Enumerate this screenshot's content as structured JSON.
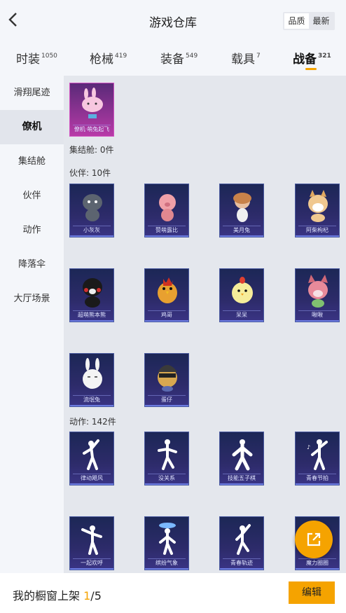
{
  "header": {
    "title": "游戏仓库",
    "sort_options": [
      "品质",
      "最新"
    ]
  },
  "tabs": [
    {
      "label": "时装",
      "count": "1050"
    },
    {
      "label": "枪械",
      "count": "419"
    },
    {
      "label": "装备",
      "count": "549"
    },
    {
      "label": "载具",
      "count": "7"
    },
    {
      "label": "战备",
      "count": "321"
    }
  ],
  "sidebar": [
    "滑翔尾迹",
    "僚机",
    "集结舱",
    "伙伴",
    "动作",
    "降落伞",
    "大厅场景"
  ],
  "sections": {
    "wingman_item": "僚机·萌兔起飞",
    "assembly_label": "集结舱: 0件",
    "partner_label": "伙伴: 10件",
    "partners": [
      "小灰灰",
      "赞萌露比",
      "美月兔",
      "阿柴枸杞",
      "超萌熊本熊",
      "鸡哥",
      "呆呆",
      "啾啾",
      "流氓兔",
      "蛋仔"
    ],
    "action_label": "动作: 142件",
    "actions": [
      "律动飓风",
      "没关系",
      "技能五子棋",
      "青春节拍",
      "一起欢呼",
      "缤纷气象",
      "青春轨迹",
      "魔力圈圈"
    ]
  },
  "footer": {
    "label": "我的橱窗上架",
    "current": "1",
    "total": "/5",
    "edit": "编辑"
  },
  "colors": {
    "accent": "#f5a300",
    "card_bg": "#1c2756"
  }
}
